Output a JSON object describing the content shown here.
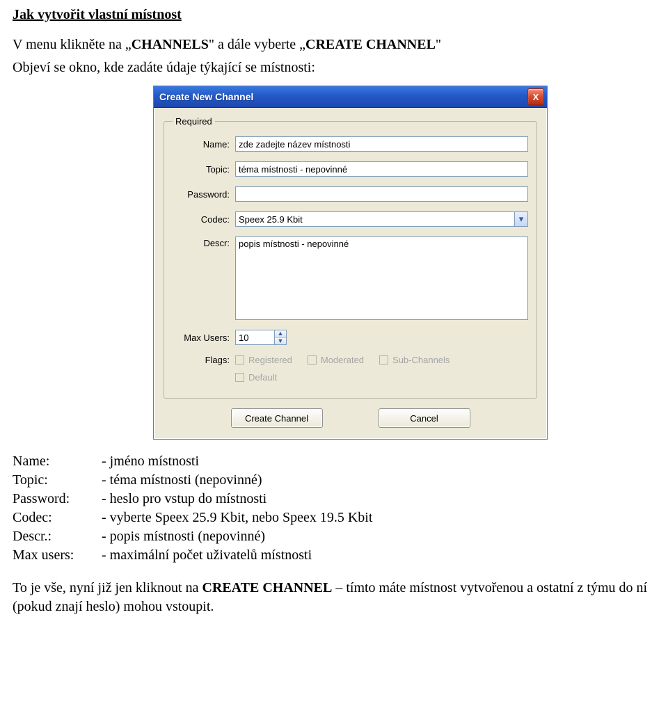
{
  "heading": "Jak vytvořit vlastní místnost",
  "intro_line1_pre": "V menu klikněte na „",
  "intro_line1_b": "CHANNELS",
  "intro_line1_mid": "\" a dále vyberte „",
  "intro_line1_b2": "CREATE CHANNEL",
  "intro_line1_post": "\"",
  "intro_line2": "Objeví se okno, kde zadáte údaje týkající se místnosti:",
  "dialog": {
    "title": "Create New Channel",
    "close_x": "X",
    "group_required": "Required",
    "labels": {
      "name": "Name:",
      "topic": "Topic:",
      "password": "Password:",
      "codec": "Codec:",
      "descr": "Descr:",
      "max_users": "Max Users:",
      "flags": "Flags:"
    },
    "values": {
      "name": "zde zadejte název místnosti",
      "topic": "téma místnosti - nepovinné",
      "password": "",
      "codec": "Speex 25.9 Kbit",
      "descr": "popis místnosti - nepovinné",
      "max_users": "10"
    },
    "flags": {
      "registered": "Registered",
      "moderated": "Moderated",
      "sub_channels": "Sub-Channels",
      "default": "Default"
    },
    "buttons": {
      "create": "Create Channel",
      "cancel": "Cancel"
    }
  },
  "explain": {
    "name_k": "Name:",
    "name_v": "- jméno místnosti",
    "topic_k": "Topic:",
    "topic_v": "- téma místnosti (nepovinné)",
    "password_k": "Password:",
    "password_v": "- heslo pro vstup do místnosti",
    "codec_k": "Codec:",
    "codec_v": "- vyberte Speex 25.9 Kbit, nebo Speex 19.5 Kbit",
    "descr_k": "Descr.:",
    "descr_v": "- popis místnosti (nepovinné)",
    "max_k": "Max users:",
    "max_v": "- maximální počet uživatelů místnosti"
  },
  "conclusion_pre": "To je vše, nyní již jen kliknout na ",
  "conclusion_b": "CREATE CHANNEL",
  "conclusion_post": " – tímto máte místnost vytvořenou a ostatní z týmu do ní (pokud znají heslo) mohou vstoupit."
}
